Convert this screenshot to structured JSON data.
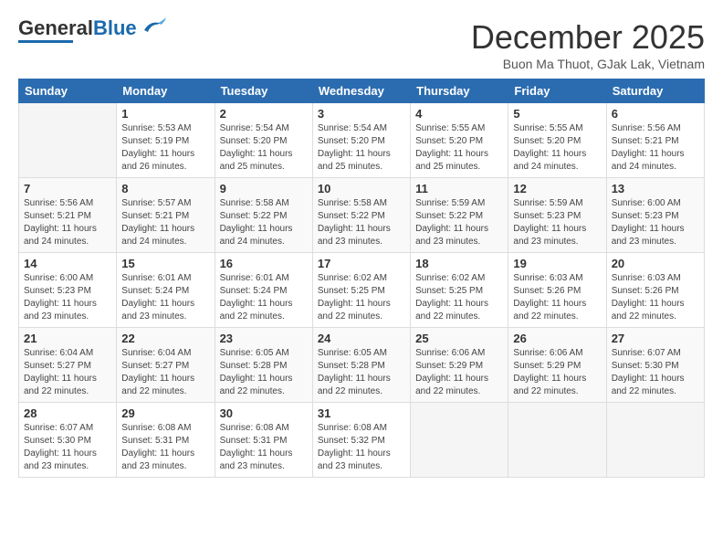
{
  "header": {
    "logo_general": "General",
    "logo_blue": "Blue",
    "month_year": "December 2025",
    "location": "Buon Ma Thuot, GJak Lak, Vietnam"
  },
  "days_of_week": [
    "Sunday",
    "Monday",
    "Tuesday",
    "Wednesday",
    "Thursday",
    "Friday",
    "Saturday"
  ],
  "weeks": [
    [
      {
        "day": "",
        "info": ""
      },
      {
        "day": "1",
        "info": "Sunrise: 5:53 AM\nSunset: 5:19 PM\nDaylight: 11 hours\nand 26 minutes."
      },
      {
        "day": "2",
        "info": "Sunrise: 5:54 AM\nSunset: 5:20 PM\nDaylight: 11 hours\nand 25 minutes."
      },
      {
        "day": "3",
        "info": "Sunrise: 5:54 AM\nSunset: 5:20 PM\nDaylight: 11 hours\nand 25 minutes."
      },
      {
        "day": "4",
        "info": "Sunrise: 5:55 AM\nSunset: 5:20 PM\nDaylight: 11 hours\nand 25 minutes."
      },
      {
        "day": "5",
        "info": "Sunrise: 5:55 AM\nSunset: 5:20 PM\nDaylight: 11 hours\nand 24 minutes."
      },
      {
        "day": "6",
        "info": "Sunrise: 5:56 AM\nSunset: 5:21 PM\nDaylight: 11 hours\nand 24 minutes."
      }
    ],
    [
      {
        "day": "7",
        "info": "Sunrise: 5:56 AM\nSunset: 5:21 PM\nDaylight: 11 hours\nand 24 minutes."
      },
      {
        "day": "8",
        "info": "Sunrise: 5:57 AM\nSunset: 5:21 PM\nDaylight: 11 hours\nand 24 minutes."
      },
      {
        "day": "9",
        "info": "Sunrise: 5:58 AM\nSunset: 5:22 PM\nDaylight: 11 hours\nand 24 minutes."
      },
      {
        "day": "10",
        "info": "Sunrise: 5:58 AM\nSunset: 5:22 PM\nDaylight: 11 hours\nand 23 minutes."
      },
      {
        "day": "11",
        "info": "Sunrise: 5:59 AM\nSunset: 5:22 PM\nDaylight: 11 hours\nand 23 minutes."
      },
      {
        "day": "12",
        "info": "Sunrise: 5:59 AM\nSunset: 5:23 PM\nDaylight: 11 hours\nand 23 minutes."
      },
      {
        "day": "13",
        "info": "Sunrise: 6:00 AM\nSunset: 5:23 PM\nDaylight: 11 hours\nand 23 minutes."
      }
    ],
    [
      {
        "day": "14",
        "info": "Sunrise: 6:00 AM\nSunset: 5:23 PM\nDaylight: 11 hours\nand 23 minutes."
      },
      {
        "day": "15",
        "info": "Sunrise: 6:01 AM\nSunset: 5:24 PM\nDaylight: 11 hours\nand 23 minutes."
      },
      {
        "day": "16",
        "info": "Sunrise: 6:01 AM\nSunset: 5:24 PM\nDaylight: 11 hours\nand 22 minutes."
      },
      {
        "day": "17",
        "info": "Sunrise: 6:02 AM\nSunset: 5:25 PM\nDaylight: 11 hours\nand 22 minutes."
      },
      {
        "day": "18",
        "info": "Sunrise: 6:02 AM\nSunset: 5:25 PM\nDaylight: 11 hours\nand 22 minutes."
      },
      {
        "day": "19",
        "info": "Sunrise: 6:03 AM\nSunset: 5:26 PM\nDaylight: 11 hours\nand 22 minutes."
      },
      {
        "day": "20",
        "info": "Sunrise: 6:03 AM\nSunset: 5:26 PM\nDaylight: 11 hours\nand 22 minutes."
      }
    ],
    [
      {
        "day": "21",
        "info": "Sunrise: 6:04 AM\nSunset: 5:27 PM\nDaylight: 11 hours\nand 22 minutes."
      },
      {
        "day": "22",
        "info": "Sunrise: 6:04 AM\nSunset: 5:27 PM\nDaylight: 11 hours\nand 22 minutes."
      },
      {
        "day": "23",
        "info": "Sunrise: 6:05 AM\nSunset: 5:28 PM\nDaylight: 11 hours\nand 22 minutes."
      },
      {
        "day": "24",
        "info": "Sunrise: 6:05 AM\nSunset: 5:28 PM\nDaylight: 11 hours\nand 22 minutes."
      },
      {
        "day": "25",
        "info": "Sunrise: 6:06 AM\nSunset: 5:29 PM\nDaylight: 11 hours\nand 22 minutes."
      },
      {
        "day": "26",
        "info": "Sunrise: 6:06 AM\nSunset: 5:29 PM\nDaylight: 11 hours\nand 22 minutes."
      },
      {
        "day": "27",
        "info": "Sunrise: 6:07 AM\nSunset: 5:30 PM\nDaylight: 11 hours\nand 22 minutes."
      }
    ],
    [
      {
        "day": "28",
        "info": "Sunrise: 6:07 AM\nSunset: 5:30 PM\nDaylight: 11 hours\nand 23 minutes."
      },
      {
        "day": "29",
        "info": "Sunrise: 6:08 AM\nSunset: 5:31 PM\nDaylight: 11 hours\nand 23 minutes."
      },
      {
        "day": "30",
        "info": "Sunrise: 6:08 AM\nSunset: 5:31 PM\nDaylight: 11 hours\nand 23 minutes."
      },
      {
        "day": "31",
        "info": "Sunrise: 6:08 AM\nSunset: 5:32 PM\nDaylight: 11 hours\nand 23 minutes."
      },
      {
        "day": "",
        "info": ""
      },
      {
        "day": "",
        "info": ""
      },
      {
        "day": "",
        "info": ""
      }
    ]
  ]
}
